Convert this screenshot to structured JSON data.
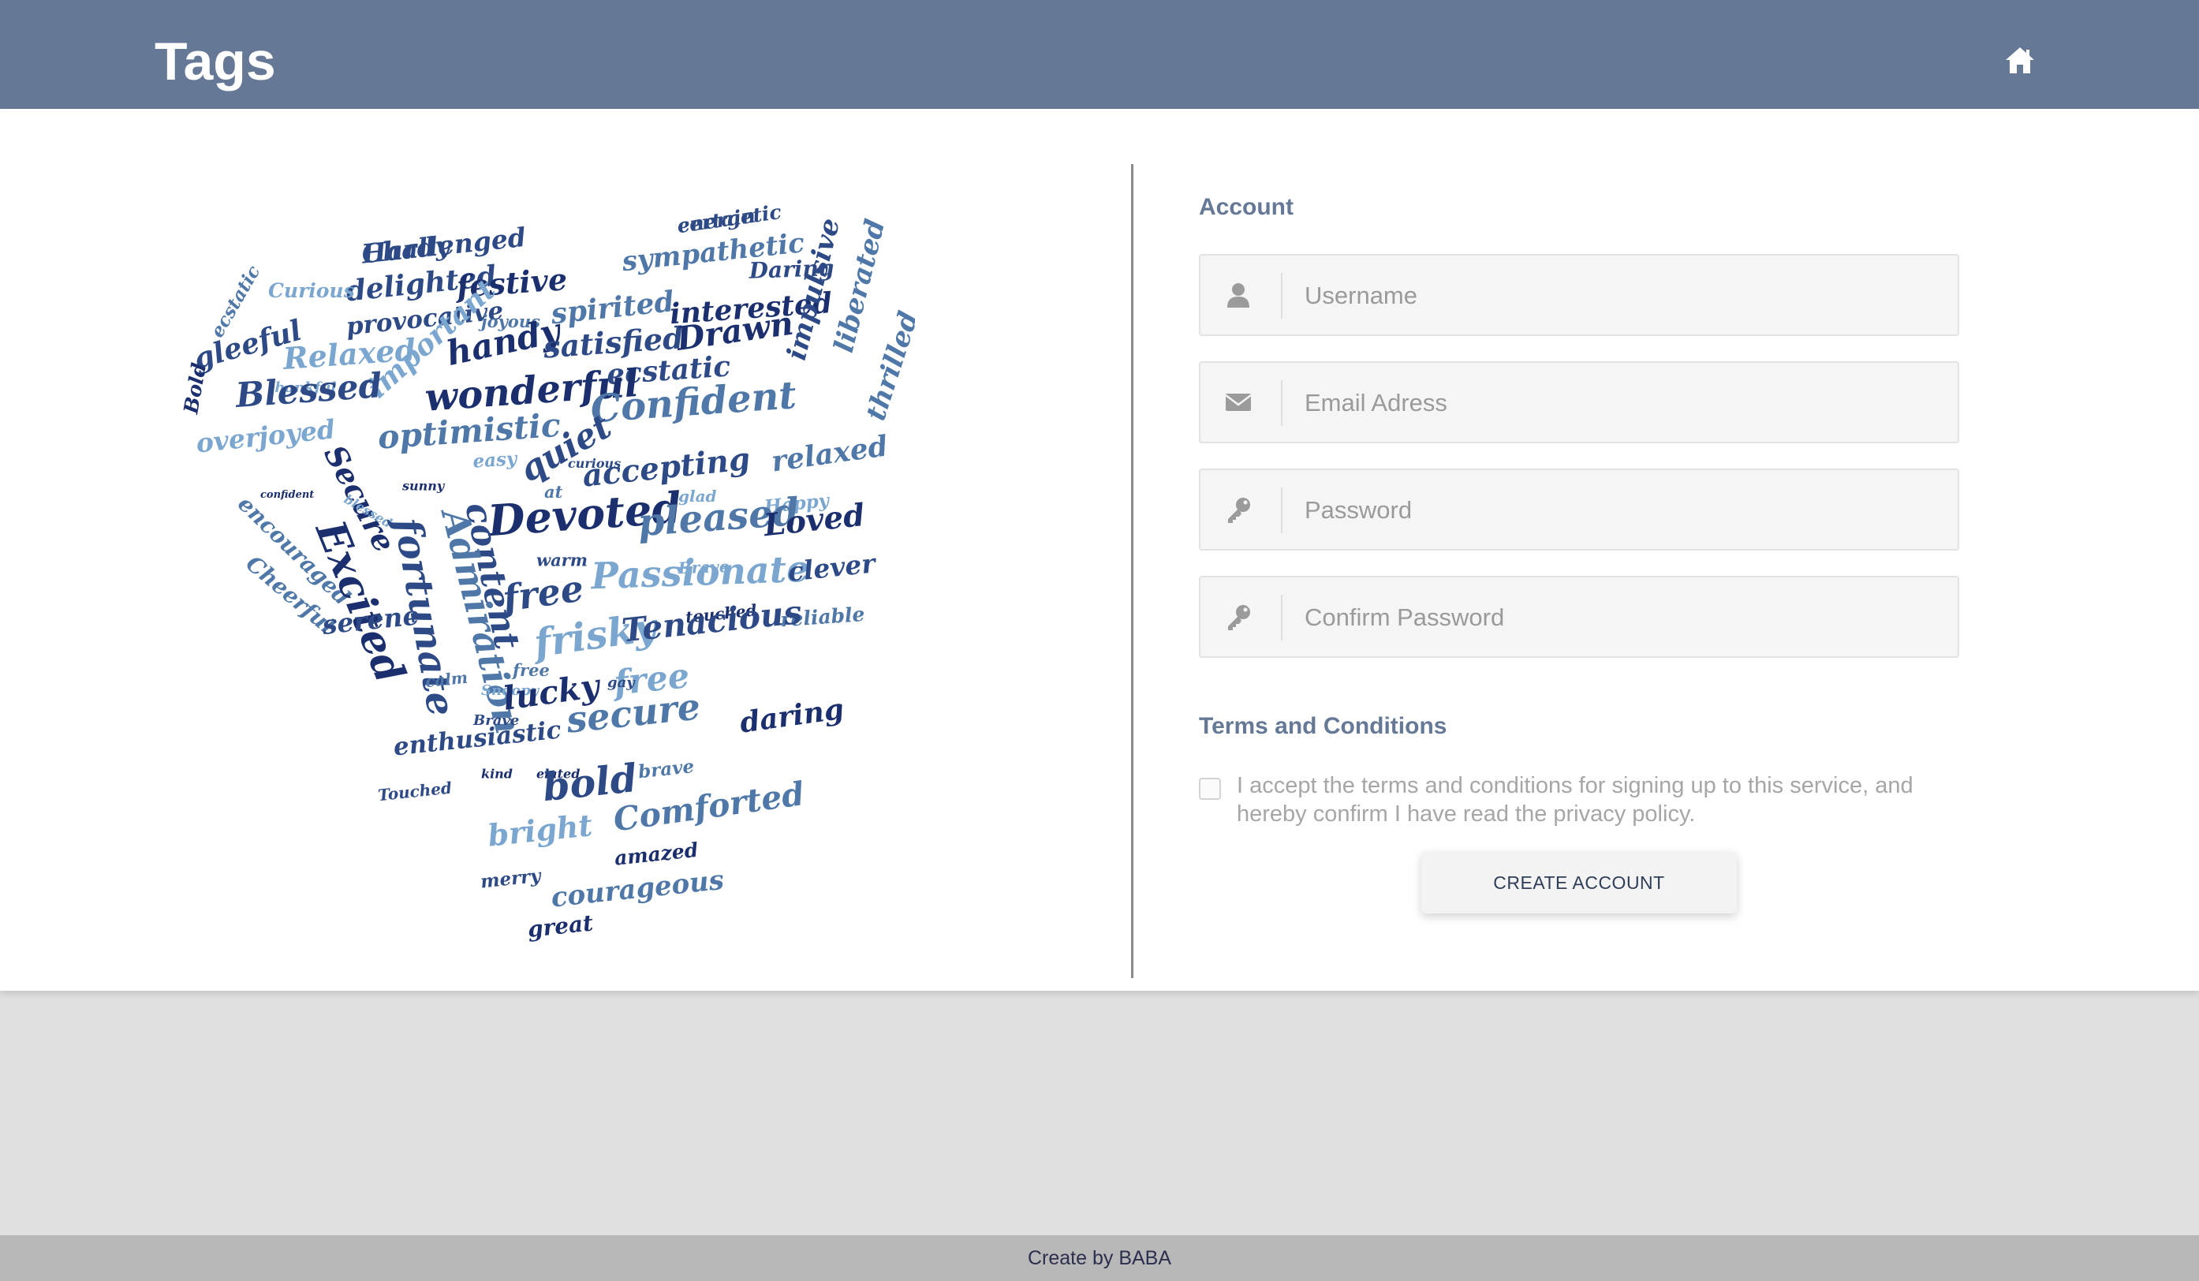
{
  "header": {
    "title": "Tags",
    "home_icon": "home-icon",
    "background": "#657896"
  },
  "word_cloud": {
    "shape": "heart",
    "palette": [
      "#1b2f6e",
      "#2d4a86",
      "#4f78a8",
      "#7aa6cf",
      "#5a6e8c"
    ],
    "words": [
      "energetic",
      "Challenged",
      "sympathetic",
      "Daring",
      "delighted",
      "festive",
      "ecstatic",
      "Curious",
      "provocative",
      "joyous",
      "spirited",
      "interested",
      "gleeful",
      "Relaxed",
      "important",
      "handy",
      "satisfied",
      "Drawn",
      "impulsive",
      "liberated",
      "thankful",
      "ecstatic",
      "Bold",
      "Blessed",
      "wonderful",
      "Confident",
      "thrilled",
      "overjoyed",
      "optimistic",
      "curious",
      "accepting",
      "relaxed",
      "Secure",
      "easy",
      "quiet",
      "at",
      "glad",
      "Happy",
      "encouraged",
      "confident",
      "sunny",
      "Devoted",
      "pleased",
      "Loved",
      "blessed",
      "content",
      "warm",
      "Brave",
      "Passionate",
      "Excited",
      "fortunate",
      "Admiration",
      "free",
      "clever",
      "Cheerful",
      "touched",
      "reliable",
      "frisky",
      "Tenacious",
      "free",
      "free",
      "serene",
      "Snoopy",
      "lucky",
      "gay",
      "Brave",
      "calm",
      "secure",
      "daring",
      "enthusiastic",
      "kind",
      "elated",
      "brave",
      "bold",
      "Touched",
      "Comforted",
      "bright",
      "amazed",
      "merry",
      "courageous",
      "great",
      "certain",
      "Hardy"
    ]
  },
  "account": {
    "title": "Account",
    "username_placeholder": "Username",
    "email_placeholder": "Email Adress",
    "password_placeholder": "Password",
    "confirm_placeholder": "Confirm Password",
    "username_icon": "user-icon",
    "email_icon": "envelope-icon",
    "password_icon": "key-icon",
    "confirm_icon": "key-icon"
  },
  "terms": {
    "title": "Terms and Conditions",
    "text": "I accept the terms and conditions for signing up to this service, and hereby confirm I have read the privacy policy.",
    "checked": false
  },
  "create_button": "CREATE ACCOUNT",
  "footer": {
    "text": "Create by BABA"
  }
}
